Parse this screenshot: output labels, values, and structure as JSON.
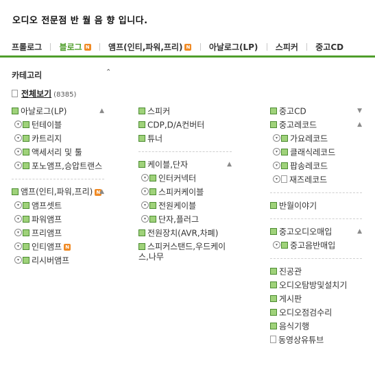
{
  "intro": "오디오 전문점 반 월 음 향 입니다.",
  "tabs": [
    {
      "label": "프롤로그",
      "active": false,
      "new": false
    },
    {
      "label": "블로그",
      "active": true,
      "new": true
    },
    {
      "label": "앰프(인티,파워,프리)",
      "active": false,
      "new": true
    },
    {
      "label": "아날로그(LP)",
      "active": false,
      "new": false
    },
    {
      "label": "스피커",
      "active": false,
      "new": false
    },
    {
      "label": "중고CD",
      "active": false,
      "new": false
    }
  ],
  "new_badge": "N",
  "category": {
    "title": "카테고리",
    "toggle": "⌃"
  },
  "view_all": {
    "label": "전체보기",
    "count": "(8385)"
  },
  "columns": {
    "col1": {
      "g1": {
        "label": "아날로그(LP)",
        "items": [
          "턴테이블",
          "카트리지",
          "액세서리 및 툴",
          "포노앰프,승압트랜스"
        ]
      },
      "g2": {
        "label": "앰프(인티,파워,프리)",
        "items": [
          "앰프셋트",
          "파워앰프",
          "프리앰프",
          "인티앰프",
          "리시버앰프"
        ]
      }
    },
    "col2": {
      "speaker": "스피커",
      "cdp": "CDP,D/A컨버터",
      "tuner": "튜너",
      "cable": {
        "label": "케이블,단자",
        "items": [
          "인터커넥터",
          "스피커케이블",
          "전원케이블",
          "단자,플러그"
        ]
      },
      "power": "전원장치(AVR,차폐)",
      "stand": "스피커스탠드,우드케이스,나무"
    },
    "col3": {
      "usedcd": "중고CD",
      "usedrecord": {
        "label": "중고레코드",
        "items": [
          "가요레코드",
          "클래식레코드",
          "팝송레코드",
          "재즈레코드"
        ]
      },
      "story": "반월이야기",
      "audiobuy": {
        "label": "중고오디오매입",
        "items": [
          "중고음반매입"
        ]
      },
      "more": [
        "진공관",
        "오디오탐방및설치기",
        "게시판",
        "오디오점검수리",
        "음식기행",
        "동영상유튜브"
      ]
    }
  },
  "colors": {
    "accent": "#4f9e2b",
    "badge": "#f08a24"
  }
}
